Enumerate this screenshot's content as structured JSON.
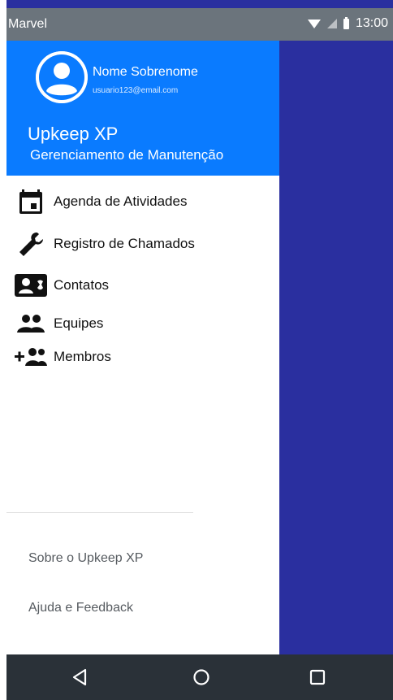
{
  "status_bar": {
    "title": "Marvel",
    "time": "13:00"
  },
  "drawer": {
    "user": {
      "name": "Nome Sobrenome",
      "email": "usuario123@email.com"
    },
    "app_title": "Upkeep XP",
    "app_subtitle": "Gerenciamento de Manutenção",
    "menu": [
      {
        "label": "Agenda de Atividades",
        "icon": "calendar-icon"
      },
      {
        "label": "Registro de Chamados",
        "icon": "wrench-icon"
      },
      {
        "label": "Contatos",
        "icon": "contacts-icon"
      },
      {
        "label": "Equipes",
        "icon": "people-icon"
      },
      {
        "label": "Membros",
        "icon": "add-group-icon"
      }
    ],
    "footer": {
      "about": "Sobre o Upkeep XP",
      "help": "Ajuda e Feedback"
    }
  },
  "colors": {
    "header": "#0a7bff",
    "scrim": "#2a2f9f",
    "status_bar": "#6b747c",
    "nav_bar": "#2a3138"
  },
  "nav_bar": {
    "buttons": [
      "back-icon",
      "home-icon",
      "recents-icon"
    ]
  }
}
